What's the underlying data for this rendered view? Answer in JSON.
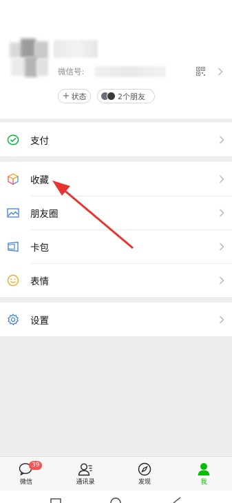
{
  "profile": {
    "wechat_id_label": "微信号:",
    "status_button": "状态",
    "status_plus": "+",
    "friends_text": "2个朋友"
  },
  "menu": {
    "pay": "支付",
    "favorites": "收藏",
    "moments": "朋友圈",
    "cards": "卡包",
    "stickers": "表情",
    "settings": "设置"
  },
  "tabs": {
    "chats": "微信",
    "chats_badge": "39",
    "contacts": "通讯录",
    "discover": "发现",
    "me": "我"
  },
  "colors": {
    "brand_green": "#09bb07",
    "badge_red": "#fa5151",
    "arrow_red": "#e8342e"
  }
}
